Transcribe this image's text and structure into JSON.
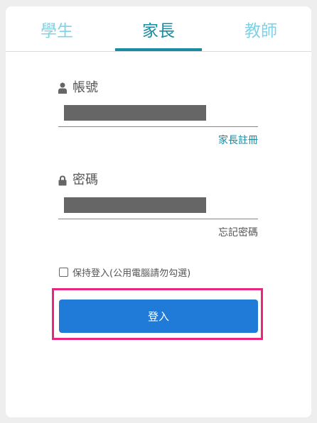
{
  "tabs": {
    "student": "學生",
    "parent": "家長",
    "teacher": "教師",
    "active": "parent",
    "active_color": "#1a8aa0",
    "inactive_color": "#7fd3e6"
  },
  "account": {
    "label": "帳號",
    "icon": "user-icon",
    "value": "[redacted]",
    "register_link": "家長註冊"
  },
  "password": {
    "label": "密碼",
    "icon": "lock-icon",
    "value": "[redacted]",
    "forgot_link": "忘記密碼"
  },
  "remember": {
    "label": "保持登入(公用電腦請勿勾選)",
    "checked": false
  },
  "login_button": {
    "label": "登入",
    "color": "#1f7ad8",
    "highlight_color": "#e8267e"
  }
}
